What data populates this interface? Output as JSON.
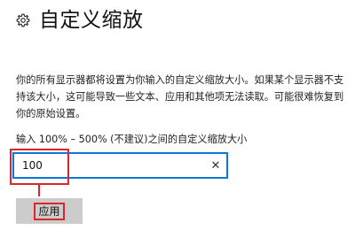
{
  "header": {
    "title": "自定义缩放",
    "icon": "gear-icon"
  },
  "description": "你的所有显示器都将设置为你输入的自定义缩放大小。如果某个显示器不支持该大小，这可能导致一些文本、应用和其他项无法读取。可能很难恢复到你的原始设置。",
  "field": {
    "label": "输入 100% – 500% (不建议)之间的自定义缩放大小",
    "value": "100",
    "clear_icon": "close-icon",
    "clear_glyph": "✕"
  },
  "apply_button": {
    "label": "应用"
  },
  "colors": {
    "accent": "#0a78d7",
    "annotation": "#e0242e",
    "button_bg": "#cccccc"
  }
}
